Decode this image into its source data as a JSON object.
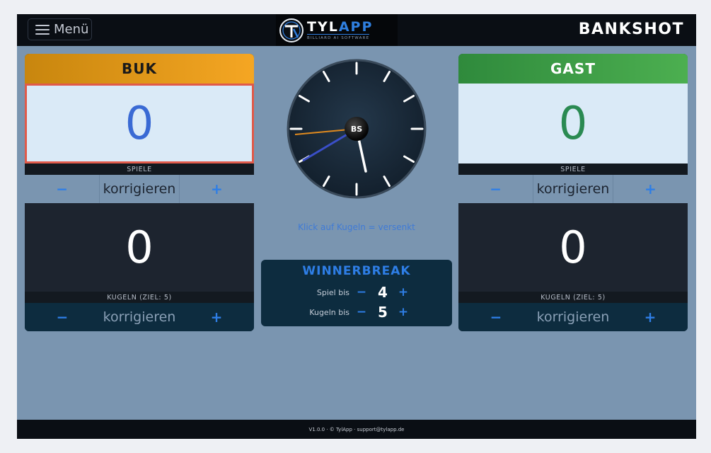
{
  "header": {
    "menu_label": "Menü",
    "logo_word_1": "TYL",
    "logo_word_2": "APP",
    "logo_sub": "BILLIARD AI SOFTWARE",
    "title": "BANKSHOT"
  },
  "players": [
    {
      "name": "BUK",
      "games": "0",
      "games_caption": "SPIELE",
      "correct_label": "korrigieren",
      "minus": "−",
      "plus": "+",
      "balls": "0",
      "balls_caption": "KUGELN (ZIEL: 5)"
    },
    {
      "name": "GAST",
      "games": "0",
      "games_caption": "SPIELE",
      "correct_label": "korrigieren",
      "minus": "−",
      "plus": "+",
      "balls": "0",
      "balls_caption": "KUGELN (ZIEL: 5)"
    }
  ],
  "clock": {
    "center_label": "BS"
  },
  "hint": "Klick auf Kugeln = versenkt",
  "winnerbreak": {
    "title": "WINNERBREAK",
    "rows": [
      {
        "label": "Spiel bis",
        "value": "4",
        "minus": "−",
        "plus": "+"
      },
      {
        "label": "Kugeln bis",
        "value": "5",
        "minus": "−",
        "plus": "+"
      }
    ]
  },
  "footer": "V1.0.0 · © TylApp · support@tylapp.de",
  "colors": {
    "accent_blue": "#2e7ee6",
    "player1_header": "#f5a623",
    "player2_header": "#4caf50",
    "active_border": "#e05a4a",
    "background": "#7a95b0"
  }
}
